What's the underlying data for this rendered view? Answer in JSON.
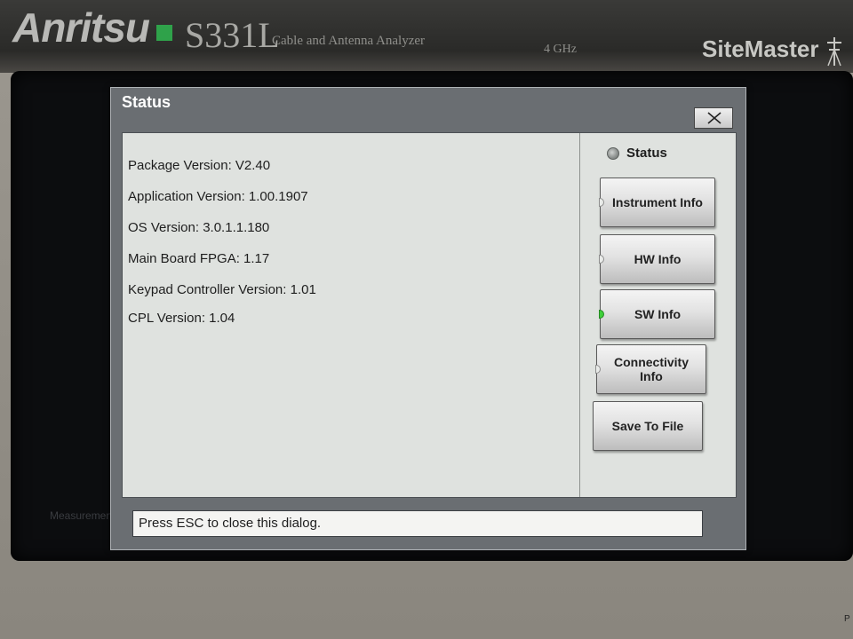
{
  "device": {
    "brand": "Anritsu",
    "model": "S331L",
    "model_description": "Cable and Antenna Analyzer",
    "frequency": "4 GHz",
    "product_name": "SiteMaster",
    "background_label": "Measurements",
    "corner_text": "P",
    "brand_color": "#2fa24a"
  },
  "dialog": {
    "title": "Status",
    "close_icon": "close-icon",
    "info_lines": [
      "Package Version: V2.40",
      "Application Version: 1.00.1907",
      "OS Version: 3.0.1.1.180",
      "Main Board FPGA: 1.17",
      "Keypad Controller Version: 1.01",
      "CPL Version: 1.04"
    ],
    "side_panel": {
      "status_label": "Status",
      "buttons": [
        {
          "label": "Instrument Info",
          "active": false
        },
        {
          "label": "HW Info",
          "active": false
        },
        {
          "label": "SW Info",
          "active": true
        },
        {
          "label": "Connectivity Info",
          "active": false
        },
        {
          "label": "Save To File"
        }
      ],
      "active_indicator_color": "#3fcf3a"
    },
    "status_message": "Press ESC to close this dialog."
  }
}
